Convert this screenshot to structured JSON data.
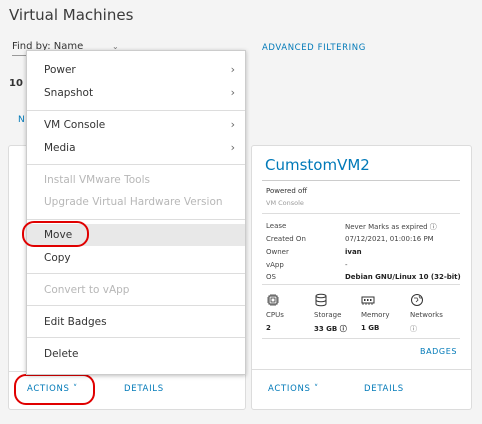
{
  "page": {
    "title": "Virtual Machines"
  },
  "filter": {
    "find_by_label": "Find by:  Name",
    "advanced_label": "ADVANCED FILTERING"
  },
  "fragments": {
    "count": "10",
    "n": "N"
  },
  "context_menu": {
    "power": "Power",
    "snapshot": "Snapshot",
    "vm_console": "VM Console",
    "media": "Media",
    "install_tools": "Install VMware Tools",
    "upgrade_hw": "Upgrade Virtual Hardware Version",
    "move": "Move",
    "copy": "Copy",
    "convert": "Convert to vApp",
    "edit_badges": "Edit Badges",
    "delete": "Delete"
  },
  "vm_card": {
    "name": "CumstomVM2",
    "power_state": "Powered off",
    "console_label": "VM Console",
    "props": [
      {
        "key": "Lease",
        "value": "Never Marks as expired ⓘ"
      },
      {
        "key": "Created On",
        "value": "07/12/2021, 01:00:16 PM"
      },
      {
        "key": "Owner",
        "value": "ivan"
      },
      {
        "key": "vApp",
        "value": "-"
      },
      {
        "key": "OS",
        "value": "Debian GNU/Linux 10 (32-bit)"
      }
    ],
    "resources": [
      {
        "label": "CPUs",
        "value": "2",
        "icon": "cpu-icon"
      },
      {
        "label": "Storage",
        "value": "33 GB ⓘ",
        "icon": "storage-icon"
      },
      {
        "label": "Memory",
        "value": "1 GB",
        "icon": "memory-icon"
      },
      {
        "label": "Networks",
        "value": "ⓘ",
        "icon": "network-icon"
      }
    ],
    "badges_label": "BADGES"
  },
  "footer": {
    "actions_label": "ACTIONS ˅",
    "details_label": "DETAILS"
  },
  "colors": {
    "accent": "#0079b8",
    "highlight_ring": "#e00000",
    "menu_hover": "#e8e8e8"
  }
}
